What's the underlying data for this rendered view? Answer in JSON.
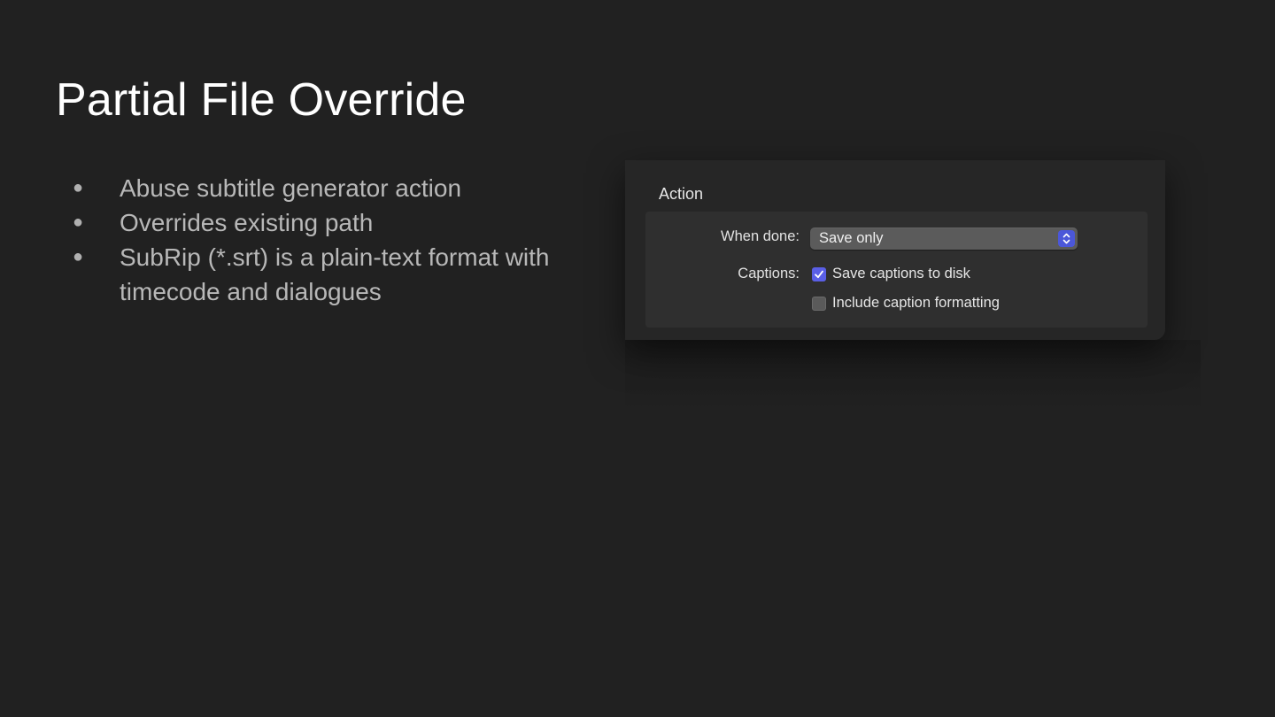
{
  "slide": {
    "title": "Partial File Override",
    "bullets": [
      "Abuse subtitle generator action",
      "Overrides existing path",
      "SubRip (*.srt) is a plain-text format with timecode and dialogues"
    ]
  },
  "panel": {
    "section_label": "Action",
    "when_done": {
      "label": "When done:",
      "selected": "Save only"
    },
    "captions": {
      "label": "Captions:",
      "options": [
        {
          "label": "Save captions to disk",
          "checked": true
        },
        {
          "label": "Include caption formatting",
          "checked": false
        }
      ]
    },
    "icons": {
      "stepper": "chevron-up-down-icon",
      "check": "checkmark-icon"
    },
    "colors": {
      "accent": "#5a5fe6",
      "background": "#212121"
    }
  }
}
